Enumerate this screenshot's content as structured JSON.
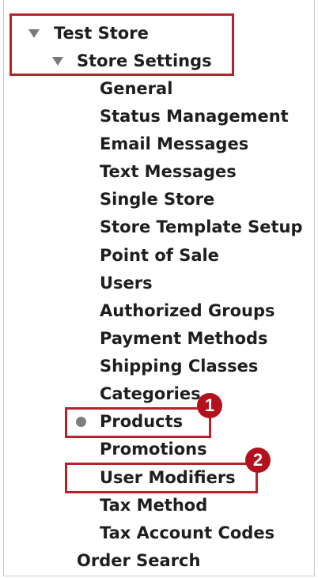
{
  "tree": {
    "root": {
      "label": "Test Store",
      "icon": "triangle-down-icon"
    },
    "store_settings": {
      "label": "Store Settings",
      "icon": "triangle-down-icon"
    },
    "children": [
      {
        "label": "General"
      },
      {
        "label": "Status Management"
      },
      {
        "label": "Email Messages"
      },
      {
        "label": "Text Messages"
      },
      {
        "label": "Single Store"
      },
      {
        "label": "Store Template Setup"
      },
      {
        "label": "Point of Sale"
      },
      {
        "label": "Users"
      },
      {
        "label": "Authorized Groups"
      },
      {
        "label": "Payment Methods"
      },
      {
        "label": "Shipping Classes"
      },
      {
        "label": "Categories"
      },
      {
        "label": "Products",
        "icon": "bullet-dot-icon",
        "selected": true
      },
      {
        "label": "Promotions"
      },
      {
        "label": "User Modifiers"
      },
      {
        "label": "Tax Method"
      },
      {
        "label": "Tax Account Codes"
      }
    ],
    "order_search": {
      "label": "Order Search"
    }
  },
  "callouts": {
    "badge_1": "1",
    "badge_2": "2",
    "color": "#b8232b"
  }
}
